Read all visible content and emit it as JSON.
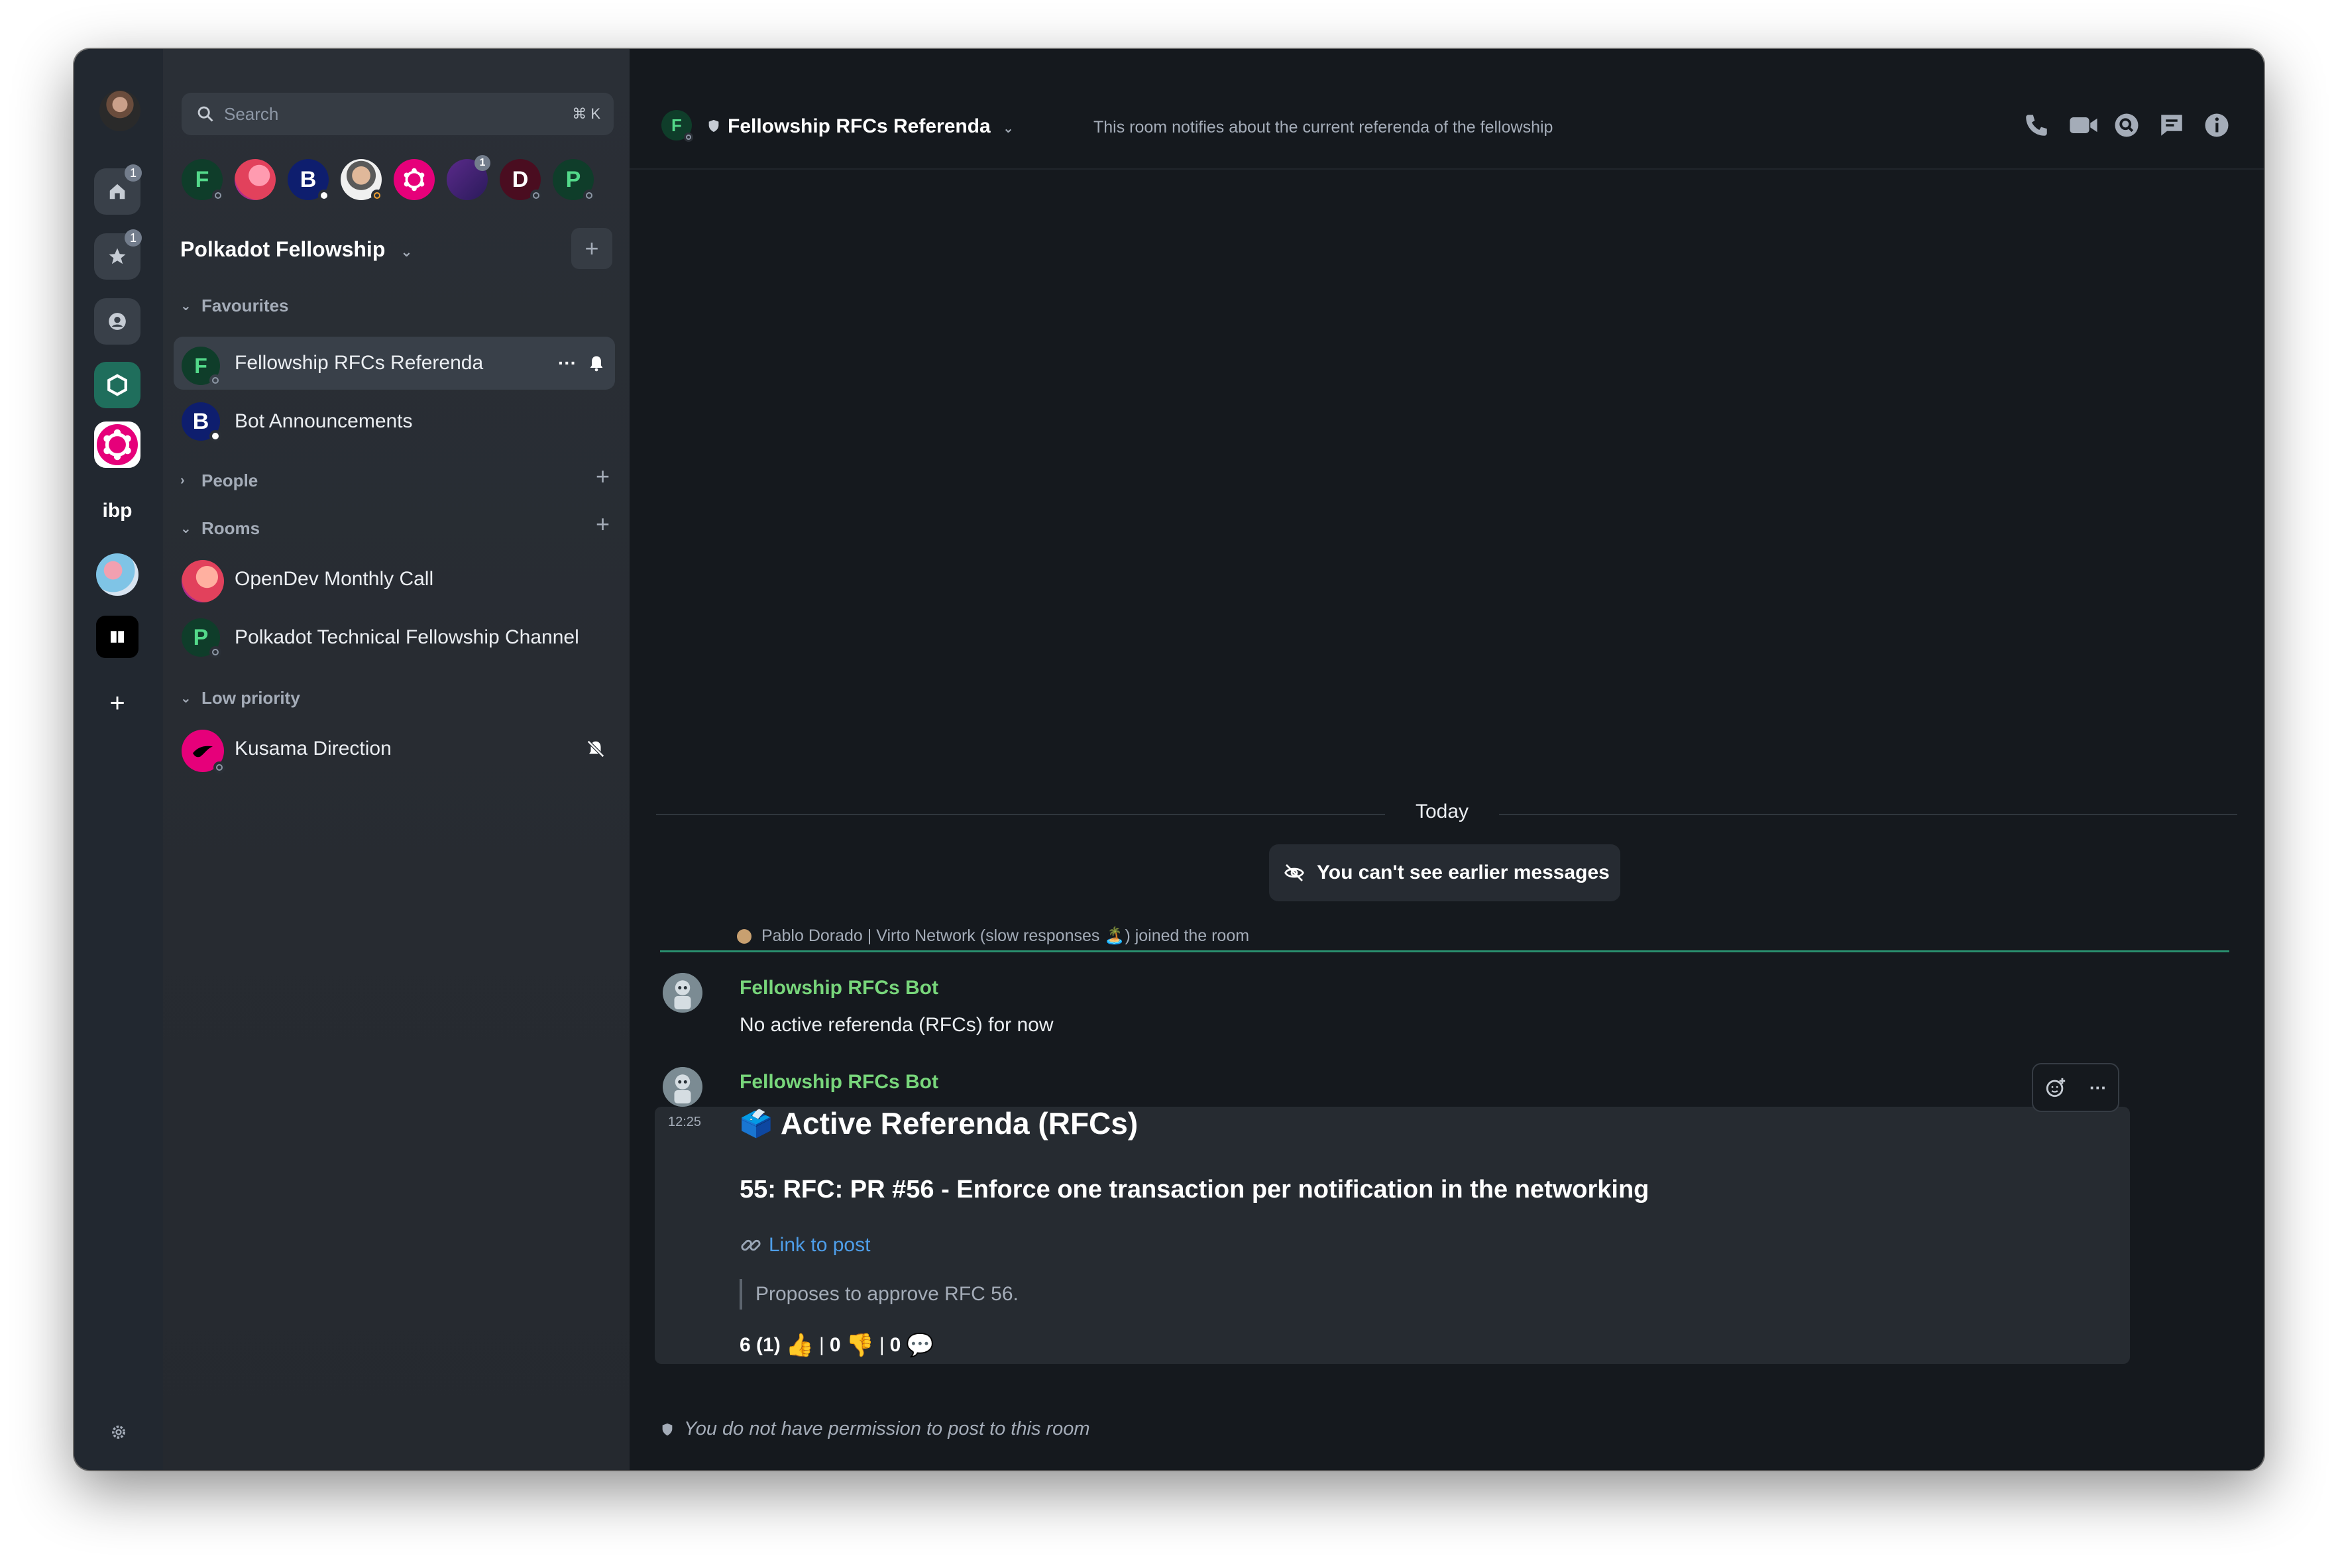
{
  "search": {
    "placeholder": "Search",
    "shortcut": "⌘ K"
  },
  "space_bar": {
    "home_badge": "1",
    "favourites_badge": "1",
    "ibp_label": "ibp",
    "add_label": "+"
  },
  "space_avatars": [
    "F",
    "",
    "B",
    "",
    "",
    "",
    "D",
    "P"
  ],
  "space_avatars_badge": "1",
  "space": {
    "name": "Polkadot Fellowship",
    "add_label": "+"
  },
  "sections": {
    "favourites": "Favourites",
    "people": "People",
    "rooms": "Rooms",
    "low_priority": "Low priority"
  },
  "rooms": {
    "favourites": [
      {
        "initial": "F",
        "name": "Fellowship RFCs Referenda"
      },
      {
        "initial": "B",
        "name": "Bot Announcements"
      }
    ],
    "rooms": [
      {
        "initial": "",
        "name": "OpenDev Monthly Call"
      },
      {
        "initial": "P",
        "name": "Polkadot Technical Fellowship Channel"
      }
    ],
    "low_priority": [
      {
        "initial": "",
        "name": "Kusama Direction"
      }
    ],
    "more_options": "···"
  },
  "header": {
    "initial": "F",
    "title": "Fellowship RFCs Referenda",
    "topic": "This room notifies about the current referenda of the fellowship"
  },
  "timeline": {
    "date_separator": "Today",
    "hidden_history": "You can't see earlier messages",
    "membership_event": "Pablo Dorado | Virto Network (slow responses 🏝️) joined the room",
    "messages": [
      {
        "sender": "Fellowship RFCs Bot",
        "body": "No active referenda (RFCs) for now"
      },
      {
        "sender": "Fellowship RFCs Bot",
        "time": "12:25",
        "heading": "Active Referenda (RFCs)",
        "heading_emoji": "🗳️",
        "subheading": "55: RFC: PR #56 - Enforce one transaction per notification in the networking",
        "link_text": "Link to post",
        "quote": "Proposes to approve RFC 56.",
        "votes": {
          "ayes": "6 (1)",
          "nays": "0",
          "comments": "0",
          "separator": "|"
        }
      }
    ],
    "more_options": "···"
  },
  "composer": {
    "notice": "You do not have permission to post to this room"
  },
  "colors": {
    "accent_green": "#78d67b",
    "link_blue": "#4e9ee9",
    "read_marker": "#2ea57d",
    "background": "#15191e"
  }
}
